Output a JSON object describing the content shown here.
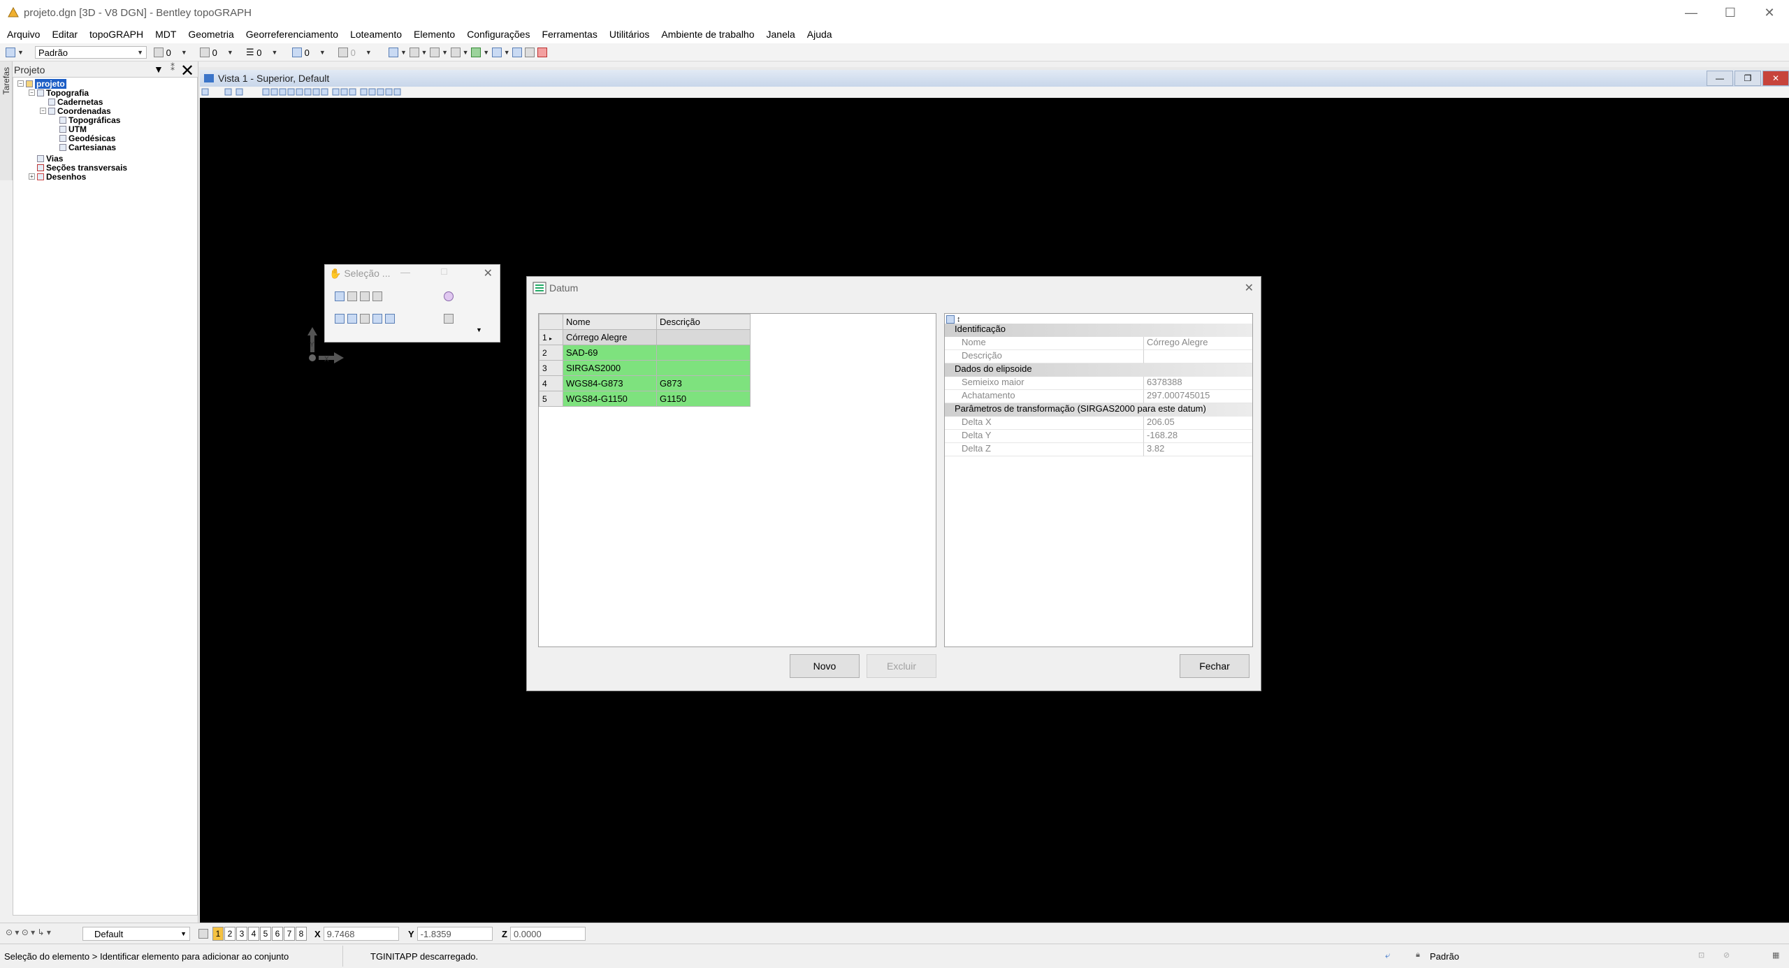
{
  "window": {
    "title": "projeto.dgn [3D - V8 DGN] - Bentley topoGRAPH",
    "min": "—",
    "max": "☐",
    "close": "✕"
  },
  "menu": [
    "Arquivo",
    "Editar",
    "topoGRAPH",
    "MDT",
    "Geometria",
    "Georreferenciamento",
    "Loteamento",
    "Elemento",
    "Configurações",
    "Ferramentas",
    "Utilitários",
    "Ambiente de trabalho",
    "Janela",
    "Ajuda"
  ],
  "toolbar": {
    "level": "Padrão",
    "color": "0",
    "style": "0",
    "weight": "0",
    "transparency": "0",
    "priority": "0"
  },
  "left_panel": {
    "tarefas": "Tarefas",
    "title": "Projeto",
    "tree": {
      "root": "projeto",
      "topografia": "Topografia",
      "cadernetas": "Cadernetas",
      "coordenadas": "Coordenadas",
      "topograficas": "Topográficas",
      "utm": "UTM",
      "geodesicas": "Geodésicas",
      "cartesianas": "Cartesianas",
      "vias": "Vias",
      "secoes": "Seções transversais",
      "desenhos": "Desenhos"
    }
  },
  "view": {
    "title": "Vista 1 - Superior, Default"
  },
  "selection_window": {
    "title": "Seleção ..."
  },
  "axis": {
    "y": "Y",
    "x": "X"
  },
  "datum_dialog": {
    "title": "Datum",
    "columns": {
      "nome": "Nome",
      "descricao": "Descrição"
    },
    "rows": [
      {
        "n": "1",
        "nome": "Córrego Alegre",
        "descricao": ""
      },
      {
        "n": "2",
        "nome": "SAD-69",
        "descricao": ""
      },
      {
        "n": "3",
        "nome": "SIRGAS2000",
        "descricao": ""
      },
      {
        "n": "4",
        "nome": "WGS84-G873",
        "descricao": "G873"
      },
      {
        "n": "5",
        "nome": "WGS84-G1150",
        "descricao": "G1150"
      }
    ],
    "props": {
      "cat1": "Identificação",
      "nome_k": "Nome",
      "nome_v": "Córrego Alegre",
      "desc_k": "Descrição",
      "desc_v": "",
      "cat2": "Dados do elipsoide",
      "semi_k": "Semieixo maior",
      "semi_v": "6378388",
      "acha_k": "Achatamento",
      "acha_v": "297.000745015",
      "cat3": "Parâmetros de transformação (SIRGAS2000 para este datum)",
      "dx_k": "Delta X",
      "dx_v": "206.05",
      "dy_k": "Delta Y",
      "dy_v": "-168.28",
      "dz_k": "Delta Z",
      "dz_v": "3.82"
    },
    "buttons": {
      "novo": "Novo",
      "excluir": "Excluir",
      "fechar": "Fechar"
    }
  },
  "statusbar": {
    "display_style": "Default",
    "views": [
      "1",
      "2",
      "3",
      "4",
      "5",
      "6",
      "7",
      "8"
    ],
    "x_label": "X",
    "x": "9.7468",
    "y_label": "Y",
    "y": "-1.8359",
    "z_label": "Z",
    "z": "0.0000",
    "prompt": "Seleção do elemento > Identificar elemento para adicionar ao conjunto",
    "message": "TGINITAPP descarregado.",
    "level": "Padrão"
  },
  "colors": {
    "canvas": "#000000",
    "highlight_row": "#7ee27e",
    "selected_tree": "#1e5fc6"
  }
}
